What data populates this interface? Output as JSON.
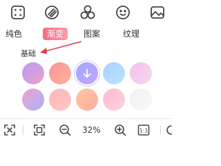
{
  "top_tools": [
    {
      "name": "crop-icon"
    },
    {
      "name": "gradient-icon"
    },
    {
      "name": "shapes-icon"
    },
    {
      "name": "emoji-icon"
    },
    {
      "name": "image-icon"
    }
  ],
  "tabs": [
    {
      "label": "纯色",
      "active": false
    },
    {
      "label": "渐变",
      "active": true
    },
    {
      "label": "图案",
      "active": false
    },
    {
      "label": "纹理",
      "active": false
    },
    {
      "label": "",
      "active": false
    }
  ],
  "section": {
    "label": "基础"
  },
  "swatches": [
    {
      "from": "#b69cf2",
      "to": "#ef9fcb",
      "selected": false
    },
    {
      "from": "#fb9497",
      "to": "#ffb29d",
      "selected": false
    },
    {
      "from": "#9ea7ff",
      "to": "#c3a6ff",
      "selected": true
    },
    {
      "from": "#a8d1ff",
      "to": "#bfe2ff",
      "selected": false
    },
    {
      "from": "#f3c1eb",
      "to": "#f5d7f1",
      "selected": false
    },
    {
      "from": "#f0a1d1",
      "to": "#a6b4f5",
      "selected": false
    },
    {
      "from": "#ffb6b8",
      "to": "#ffc6c4",
      "selected": false
    },
    {
      "from": "#ffc7a0",
      "to": "#ffac9e",
      "selected": false
    },
    {
      "from": "#ffb8d2",
      "to": "#ffd3dd",
      "selected": false
    },
    {
      "from": "#f1f1f1",
      "to": "#f8f8f8",
      "selected": false
    }
  ],
  "bottom": {
    "zoom_label": "32%",
    "fit_label": "1:1"
  },
  "colors": {
    "accent": "#f56b83",
    "arrow": "#e8394a",
    "icon": "#444444"
  }
}
